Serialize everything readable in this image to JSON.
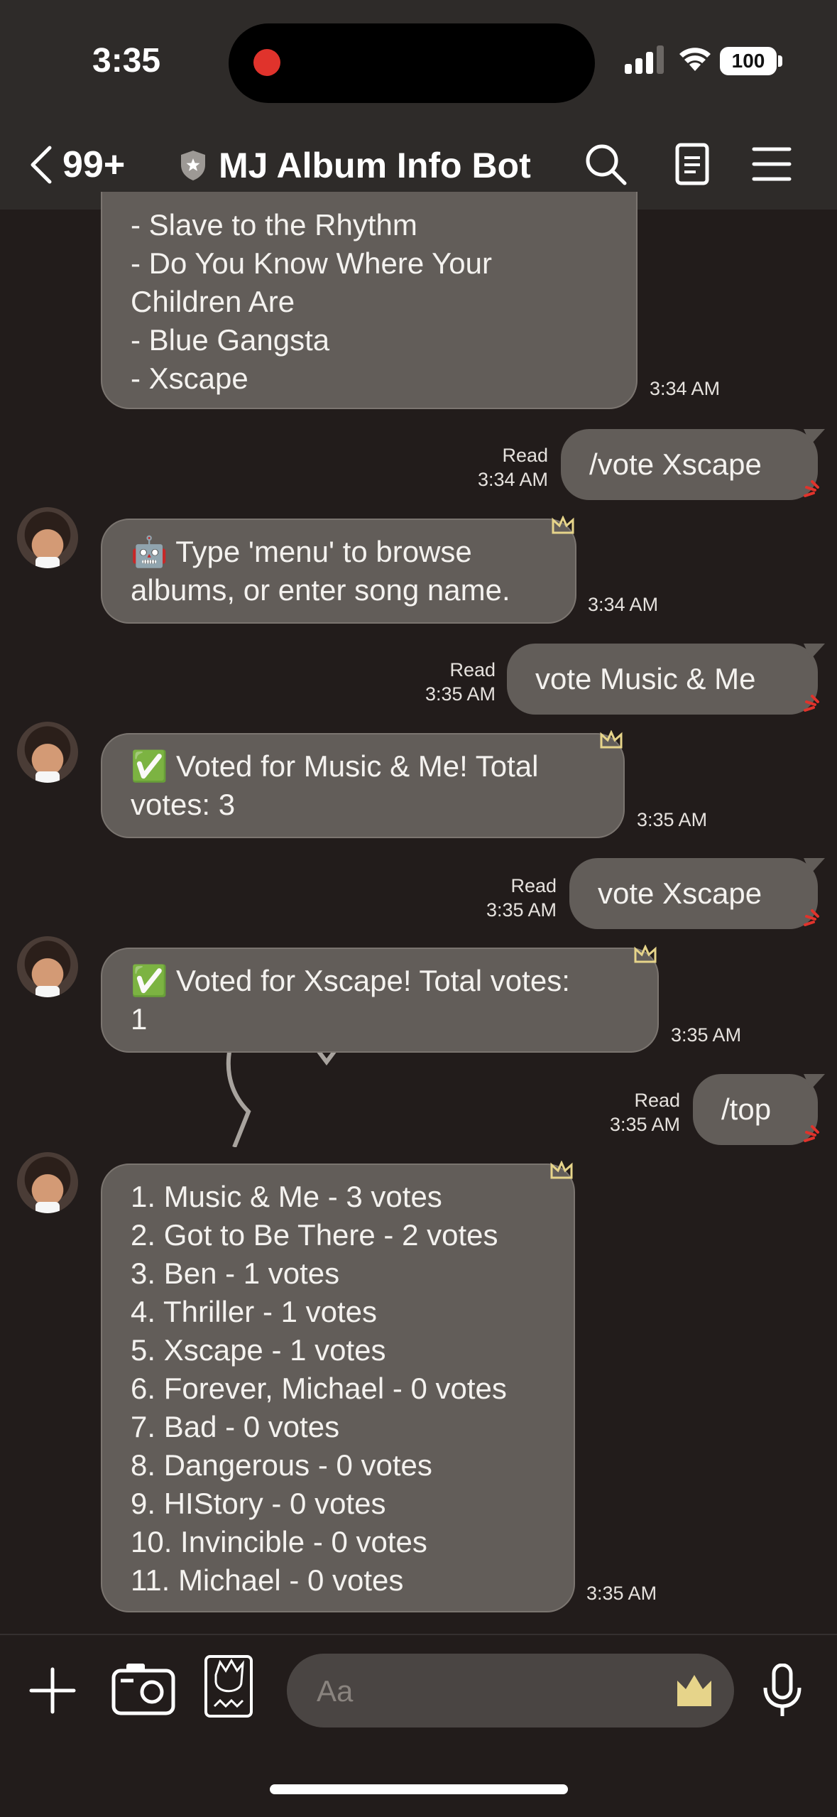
{
  "status_bar": {
    "time": "3:35",
    "battery": "100"
  },
  "header": {
    "back_count": "99+",
    "title": "MJ Album Info Bot"
  },
  "messages": [
    {
      "side": "in",
      "lines": [
        "- Slave to the Rhythm",
        "- Do You Know Where Your",
        "Children Are",
        "- Blue Gangsta",
        "- Xscape"
      ],
      "time": "3:34 AM"
    },
    {
      "side": "out",
      "text": "/vote Xscape",
      "read": "Read",
      "time": "3:34 AM"
    },
    {
      "side": "in",
      "lines": [
        "🤖 Type 'menu' to browse",
        "albums, or enter song name."
      ],
      "time": "3:34 AM"
    },
    {
      "side": "out",
      "text": "vote Music & Me",
      "read": "Read",
      "time": "3:35 AM"
    },
    {
      "side": "in",
      "lines": [
        "✅ Voted for Music & Me! Total",
        "votes: 3"
      ],
      "time": "3:35 AM"
    },
    {
      "side": "out",
      "text": "vote Xscape",
      "read": "Read",
      "time": "3:35 AM"
    },
    {
      "side": "in",
      "lines": [
        "✅ Voted for Xscape! Total votes:",
        "1"
      ],
      "time": "3:35 AM"
    },
    {
      "side": "out",
      "text": "/top",
      "read": "Read",
      "time": "3:35 AM"
    },
    {
      "side": "in",
      "lines": [
        "1. Music & Me - 3 votes",
        "2. Got to Be There - 2 votes",
        "3. Ben - 1 votes",
        "4. Thriller - 1 votes",
        "5. Xscape - 1 votes",
        "6. Forever, Michael - 0 votes",
        "7. Bad - 0 votes",
        "8. Dangerous - 0 votes",
        "9. HIStory - 0 votes",
        "10. Invincible - 0 votes",
        "11. Michael - 0 votes"
      ],
      "time": "3:35 AM"
    }
  ],
  "input": {
    "placeholder": "Aa"
  },
  "icons": {
    "back": "chevron-left-icon",
    "shield": "shield-icon",
    "search": "search-icon",
    "notes": "note-icon",
    "menu": "menu-icon",
    "plus": "plus-icon",
    "camera": "camera-icon",
    "sticker": "sticker-icon",
    "crown": "crown-icon",
    "mic": "microphone-icon"
  },
  "colors": {
    "background": "#221c1b",
    "header": "#2e2b29",
    "bubble": "#625d59",
    "accent_crown": "#e6d48a",
    "read_mark": "#e0332c"
  }
}
